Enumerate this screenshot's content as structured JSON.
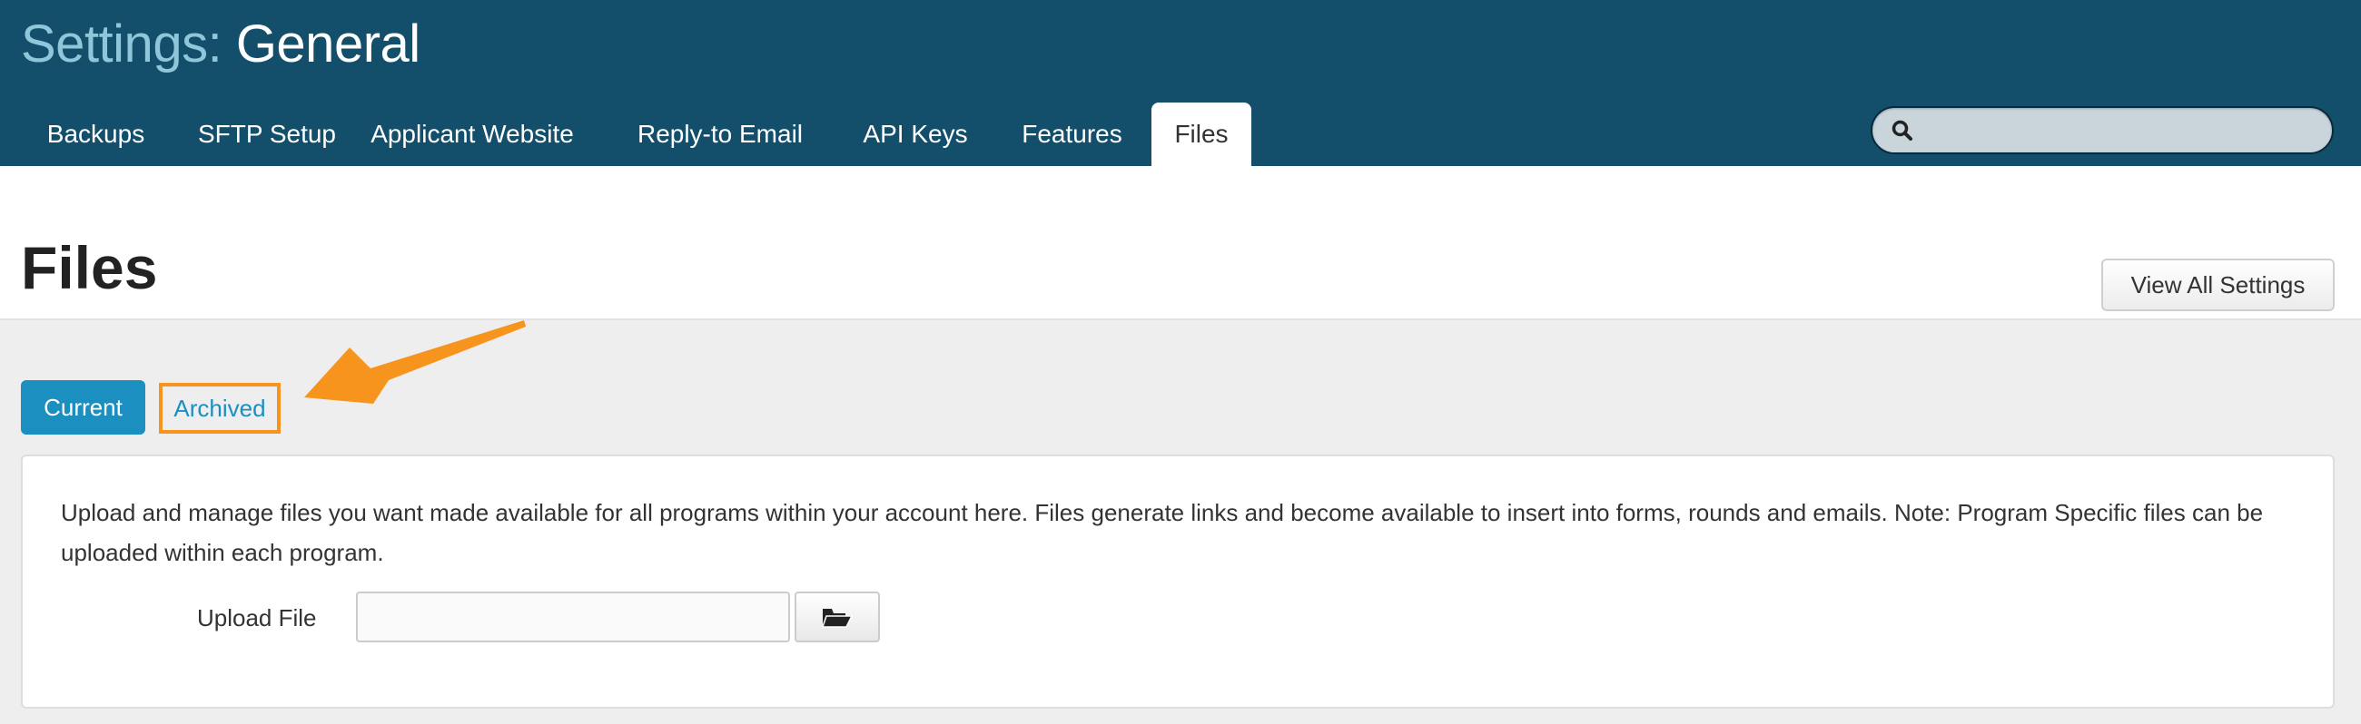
{
  "header": {
    "title_prefix": "Settings:",
    "title_main": "General",
    "background_color": "#134f6b",
    "tabs": [
      {
        "label": "Backups",
        "active": false
      },
      {
        "label": "SFTP Setup",
        "active": false
      },
      {
        "label": "Applicant Website",
        "active": false
      },
      {
        "label": "Reply-to Email",
        "active": false
      },
      {
        "label": "API Keys",
        "active": false
      },
      {
        "label": "Features",
        "active": false
      },
      {
        "label": "Files",
        "active": true
      }
    ],
    "search": {
      "placeholder": "",
      "icon": "search-icon"
    }
  },
  "page": {
    "title": "Files",
    "view_all_label": "View All Settings"
  },
  "filter": {
    "current_label": "Current",
    "archived_label": "Archived",
    "active": "Current",
    "highlight_color": "#f7941d",
    "accent_color": "#1b8fc0"
  },
  "panel": {
    "description": "Upload and manage files you want made available for all programs within your account here. Files generate links and become available to insert into forms, rounds and emails. Note: Program Specific files can be uploaded within each program.",
    "upload_label": "Upload File",
    "upload_value": "",
    "browse_icon": "folder-open-icon"
  }
}
